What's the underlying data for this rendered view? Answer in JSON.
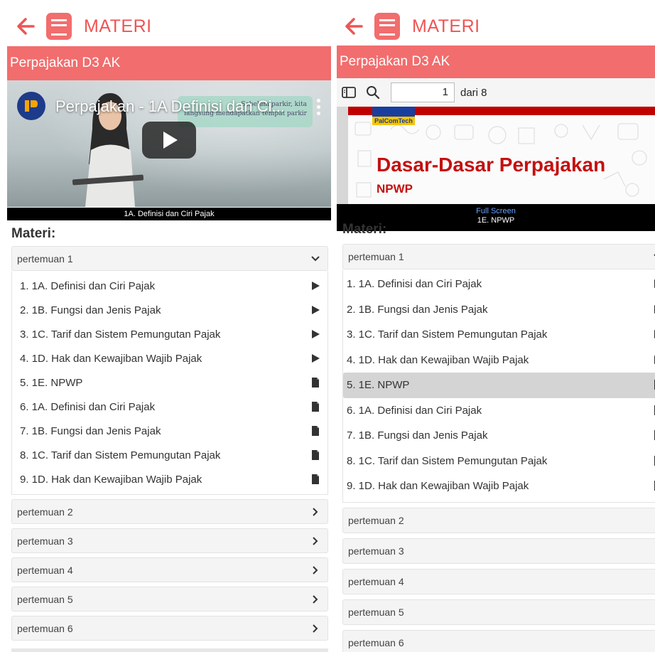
{
  "app": {
    "title": "MATERI",
    "course": "Perpajakan D3 AK"
  },
  "left": {
    "video": {
      "title": "Perpajakan - 1A Definisi dan Ci...",
      "board_text_1": "Sebelum parkir, kita",
      "board_text_2": "langsung mendapatkan tempat parkir",
      "caption": "1A. Definisi dan Ciri Pajak"
    }
  },
  "right": {
    "pdf": {
      "page_current": "1",
      "page_total_label": "dari 8",
      "brand": "PalComTech",
      "heading": "Dasar-Dasar Perpajakan",
      "subheading": "NPWP",
      "fullscreen_label": "Full Screen",
      "caption": "1E. NPWP"
    }
  },
  "materi_heading": "Materi:",
  "groups": [
    {
      "label": "pertemuan 1",
      "expanded": true
    },
    {
      "label": "pertemuan 2"
    },
    {
      "label": "pertemuan 3"
    },
    {
      "label": "pertemuan 4"
    },
    {
      "label": "pertemuan 5"
    },
    {
      "label": "pertemuan 6"
    }
  ],
  "items": [
    {
      "label": "1. 1A. Definisi dan Ciri Pajak",
      "icon": "play-icon"
    },
    {
      "label": "2. 1B. Fungsi dan Jenis Pajak",
      "icon": "play-icon"
    },
    {
      "label": "3. 1C. Tarif dan Sistem Pemungutan Pajak",
      "icon": "play-icon"
    },
    {
      "label": "4. 1D. Hak dan Kewajiban Wajib Pajak",
      "icon": "play-icon"
    },
    {
      "label": "5. 1E. NPWP",
      "icon": "document-icon"
    },
    {
      "label": "6. 1A. Definisi dan Ciri Pajak",
      "icon": "document-icon"
    },
    {
      "label": "7. 1B. Fungsi dan Jenis Pajak",
      "icon": "document-icon"
    },
    {
      "label": "8. 1C. Tarif dan Sistem Pemungutan Pajak",
      "icon": "document-icon"
    },
    {
      "label": "9. 1D. Hak dan Kewajiban Wajib Pajak",
      "icon": "document-icon"
    }
  ],
  "colors": {
    "accent": "#f26d6d",
    "title": "#ee5555",
    "active_row": "#d4d4d4"
  }
}
